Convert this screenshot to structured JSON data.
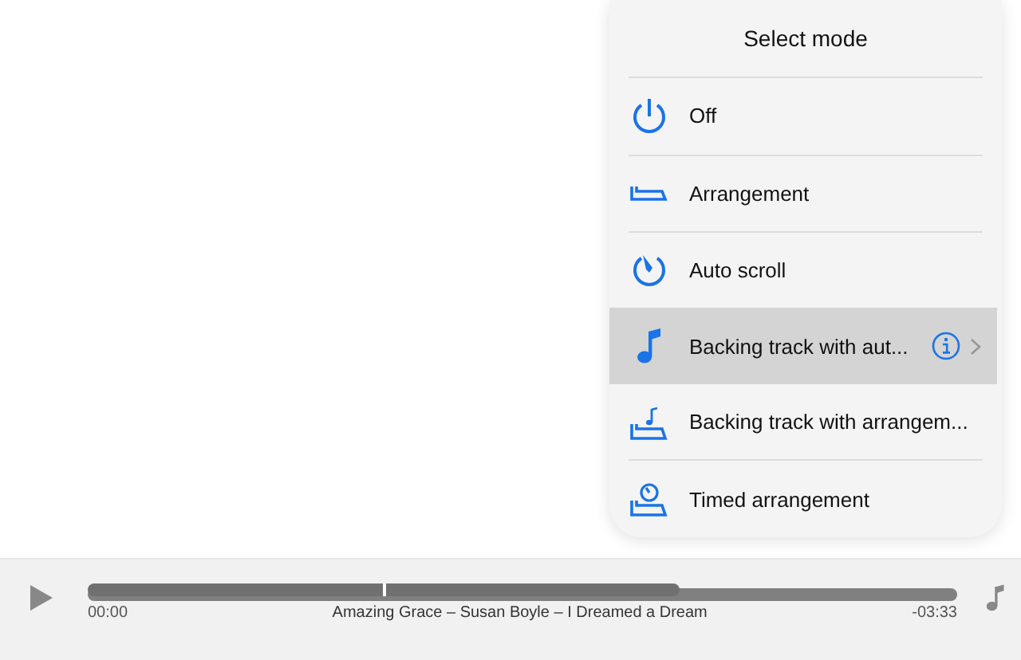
{
  "menu": {
    "title": "Select mode",
    "items": [
      {
        "kind": "power",
        "label": "Off",
        "selected": false
      },
      {
        "kind": "arrangement",
        "label": "Arrangement",
        "selected": false
      },
      {
        "kind": "autoscroll",
        "label": "Auto scroll",
        "selected": false
      },
      {
        "kind": "note",
        "label": "Backing track with aut...",
        "selected": true,
        "info": true
      },
      {
        "kind": "note-arrangement",
        "label": "Backing track with arrangem...",
        "selected": false
      },
      {
        "kind": "timer-arrangement",
        "label": "Timed arrangement",
        "selected": false
      }
    ]
  },
  "player": {
    "elapsed": "00:00",
    "track_info": "Amazing Grace  –  Susan Boyle  –  I Dreamed a Dream",
    "remaining": "-03:33",
    "level": 0.68
  }
}
